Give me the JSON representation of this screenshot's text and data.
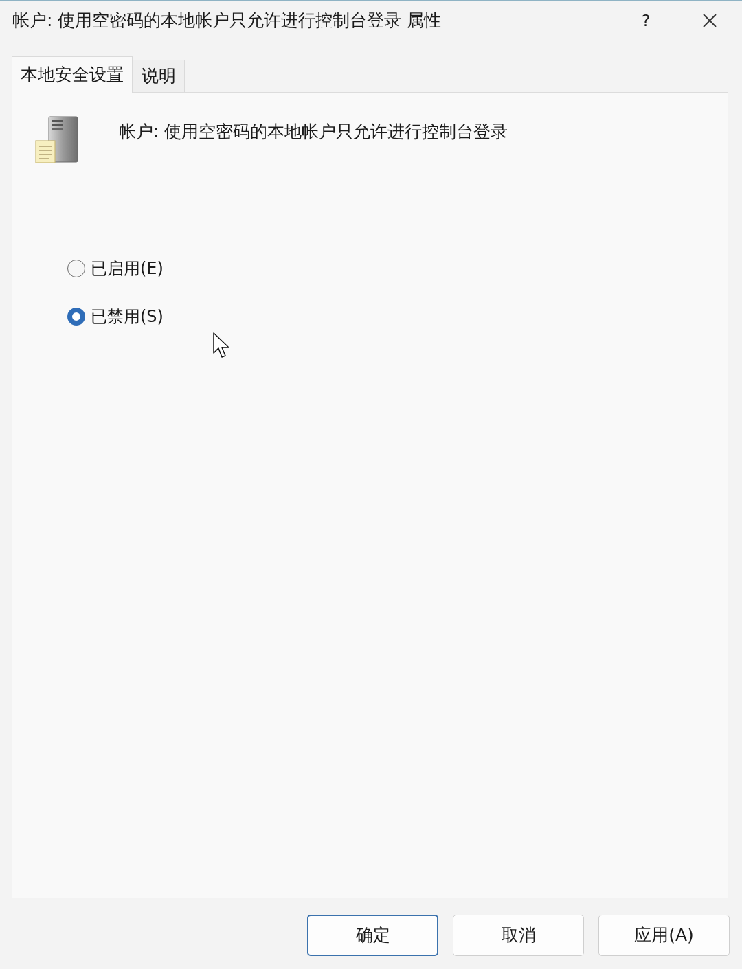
{
  "window": {
    "title": "帐户: 使用空密码的本地帐户只允许进行控制台登录 属性",
    "help": "?"
  },
  "tabs": [
    {
      "label": "本地安全设置",
      "selected": true
    },
    {
      "label": "说明",
      "selected": false
    }
  ],
  "policy": {
    "name": "帐户: 使用空密码的本地帐户只允许进行控制台登录"
  },
  "options": [
    {
      "label": "已启用(E)",
      "selected": false
    },
    {
      "label": "已禁用(S)",
      "selected": true
    }
  ],
  "buttons": [
    {
      "label": "确定",
      "default": true
    },
    {
      "label": "取消",
      "default": false
    },
    {
      "label": "应用(A)",
      "default": false
    }
  ]
}
